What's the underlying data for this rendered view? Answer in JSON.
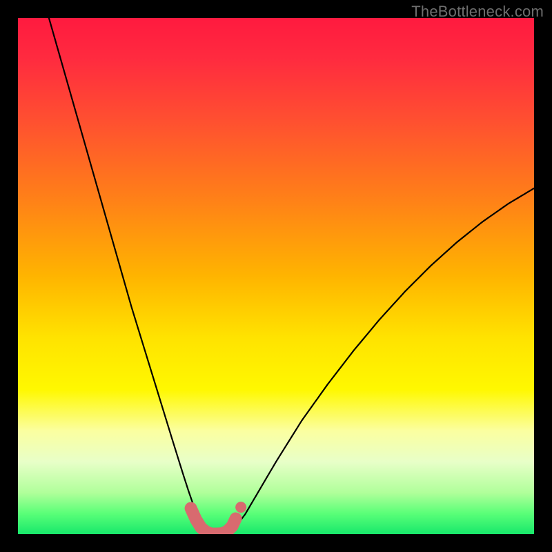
{
  "watermark": "TheBottleneck.com",
  "chart_data": {
    "type": "line",
    "title": "",
    "xlabel": "",
    "ylabel": "",
    "xlim": [
      0,
      100
    ],
    "ylim": [
      0,
      100
    ],
    "grid": false,
    "legend": false,
    "series": [
      {
        "name": "bottleneck-curve",
        "x": [
          6,
          8,
          10,
          12,
          14,
          16,
          18,
          20,
          22,
          24,
          26,
          28,
          30,
          31,
          32,
          33,
          34,
          35,
          36,
          37,
          38,
          39,
          40,
          41,
          42,
          44,
          46,
          50,
          55,
          60,
          65,
          70,
          75,
          80,
          85,
          90,
          95,
          100
        ],
        "y": [
          100,
          93,
          86,
          79,
          72,
          65,
          58,
          51,
          44,
          37.5,
          31,
          24.5,
          18,
          14.8,
          11.6,
          8.5,
          5.6,
          3.0,
          1.2,
          0.3,
          0.0,
          0.0,
          0.0,
          0.3,
          1.2,
          3.8,
          7.2,
          14.0,
          22.0,
          29.0,
          35.5,
          41.5,
          47.0,
          52.0,
          56.5,
          60.5,
          64.0,
          67.0
        ]
      }
    ],
    "highlight_region": {
      "name": "optimal-segment",
      "x": [
        33.5,
        34.5,
        35.5,
        36.5,
        37.5,
        38.5,
        39.5,
        40.5,
        41.5,
        42.2
      ],
      "y": [
        5.0,
        2.8,
        1.2,
        0.4,
        0.05,
        0.05,
        0.1,
        0.5,
        1.5,
        3.0
      ]
    },
    "highlight_point": {
      "x": 43.2,
      "y": 5.2
    },
    "gradient_stops": [
      {
        "offset": 0.0,
        "color": "#ff1a3f"
      },
      {
        "offset": 0.08,
        "color": "#ff2b3f"
      },
      {
        "offset": 0.2,
        "color": "#ff5030"
      },
      {
        "offset": 0.35,
        "color": "#ff8018"
      },
      {
        "offset": 0.5,
        "color": "#ffb400"
      },
      {
        "offset": 0.62,
        "color": "#ffe300"
      },
      {
        "offset": 0.72,
        "color": "#fff800"
      },
      {
        "offset": 0.8,
        "color": "#fbffa0"
      },
      {
        "offset": 0.86,
        "color": "#e8ffc8"
      },
      {
        "offset": 0.92,
        "color": "#b0ff9a"
      },
      {
        "offset": 0.96,
        "color": "#5aff78"
      },
      {
        "offset": 1.0,
        "color": "#18e86b"
      }
    ],
    "highlight_color": "#d86a6f"
  }
}
